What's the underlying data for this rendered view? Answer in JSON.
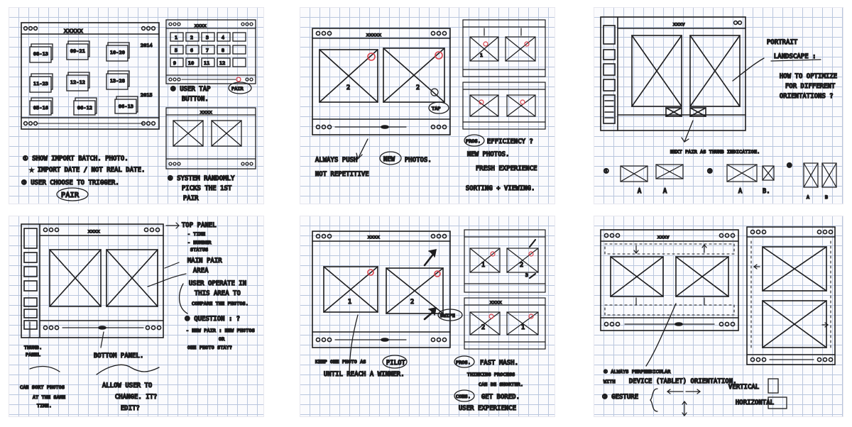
{
  "sheet1": {
    "dates": [
      "08-13",
      "09-21",
      "10-20",
      "11-23",
      "12-12",
      "13-28",
      "05-16",
      "06-12",
      "06-13"
    ],
    "year": "2014",
    "year2": "2015",
    "grid_numbers": [
      "1",
      "2",
      "3",
      "4",
      "5",
      "6",
      "7",
      "8",
      "9",
      "10",
      "11",
      "12"
    ],
    "notes": [
      "① SHOW IMPORT BATCH. PHOTO.",
      "★ IMPORT DATE / NOT REAL DATE.",
      "② USER CHOOSE TO TRIGGER.",
      "③ USER TAP",
      "BUTTON.",
      "④ SYSTEM RANDOMLY",
      "PICKS THE 1ST",
      "PAIR"
    ],
    "pair_label": "PAIR",
    "pair_label2": "PAIR",
    "title_marks": "xxxxx",
    "title_marks2": "xxxx"
  },
  "sheet2": {
    "notes": [
      "ALWAYS PUSH",
      "NEW",
      "PHOTOS.",
      "NOT REPETITIVE",
      "PROS.",
      "EFFICIENCY ?",
      "NEW PHOTOS.",
      "FRESH EXPERIENCE",
      "SORTING + VIEWING."
    ],
    "tap_label": "TAP",
    "numbers": [
      "2",
      "2",
      "1"
    ],
    "title_marks": "xxxxx"
  },
  "sheet3": {
    "notes": [
      "PORTRAIT",
      "LANDSCAPE :",
      "HOW TO OPTIMIZE",
      "FOR DIFFERENT",
      "ORIENTATIONS ?",
      "NEXT PAIR AS THUMB INDICATION."
    ],
    "options": [
      "①",
      "②",
      "③"
    ],
    "labels": [
      "A",
      "A",
      "A",
      "B.",
      "A",
      "B"
    ],
    "title_marks": "xxxv"
  },
  "sheet4": {
    "notes": [
      "TOP PANEL",
      "- TIME",
      "- NUMBER",
      "STATUS",
      "MAIN PAIR",
      "AREA",
      "USER OPERATE IN",
      "THIS AREA TO",
      "COMPARE THE PHOTOS.",
      "③ QUESTION : ?",
      "- NEW PAIR : NEW PHOTOS",
      "OR",
      "ONE PHOTO STAY?",
      "THUMB.",
      "PANEL",
      "BOTTOM PANEL.",
      "CAN SORT PHOTOS",
      "AT THE SAME",
      "TIME.",
      "ALLOW USER TO",
      "CHANGE. IT?",
      "EDIT?"
    ],
    "title_marks": "xxxx"
  },
  "sheet5": {
    "notes": [
      "KEEP ONE PHOTO AS",
      "PILOT",
      "UNTIL REACH A WINNER.",
      "PROS.",
      "FAST MASH.",
      "THINKING PROCESS",
      "CAN BE SHORTER.",
      "CONS.",
      "GET BORED.",
      "USER EXPERIENCE"
    ],
    "swipe_label": "SWIPE",
    "numbers": [
      "1",
      "2",
      "1",
      "2",
      "3",
      "2",
      "1"
    ],
    "title_marks": "xxxx"
  },
  "sheet6": {
    "notes": [
      "① ALWAYS PERPENDICULAR",
      "WITH",
      "DEVICE (TABLET) ORIENTATION.",
      "② GESTURE",
      "VERTICAL",
      "HORIZONTAL"
    ],
    "title_marks": "xxxv"
  }
}
